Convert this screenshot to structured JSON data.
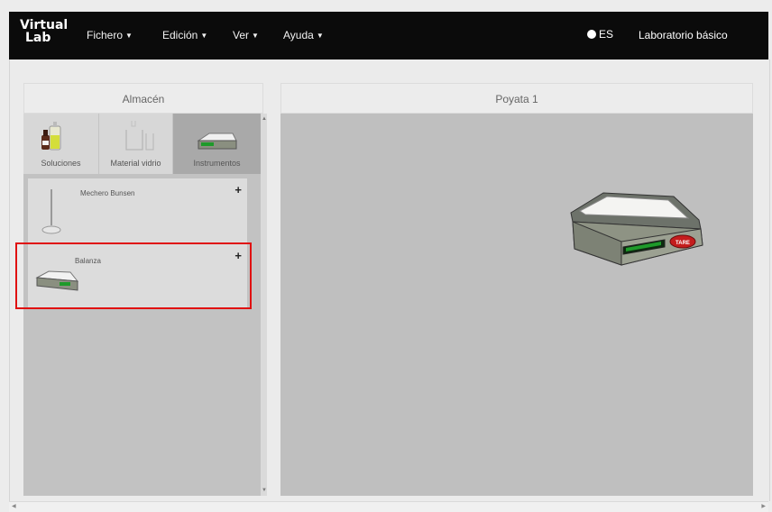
{
  "app": {
    "logo_line1": "Virtual",
    "logo_line2": "Lab"
  },
  "navbar": {
    "menus": [
      {
        "label": "Fichero"
      },
      {
        "label": "Edición"
      },
      {
        "label": "Ver"
      },
      {
        "label": "Ayuda"
      }
    ],
    "language": "ES",
    "lab_type": "Laboratorio básico"
  },
  "store": {
    "title": "Almacén",
    "categories": [
      {
        "label": "Soluciones"
      },
      {
        "label": "Material vidrio"
      },
      {
        "label": "Instrumentos",
        "active": true
      }
    ],
    "items": [
      {
        "label": "Mechero Bunsen",
        "add": "+"
      },
      {
        "label": "Balanza",
        "add": "+"
      }
    ]
  },
  "bench": {
    "title": "Poyata 1",
    "balance_button": "TARE"
  },
  "colors": {
    "navbar": "#0b0b0b",
    "highlight": "#e01010",
    "active_tab": "#a9a9a9",
    "display_green": "#1e9a2a",
    "tare_red": "#c41d1d"
  }
}
